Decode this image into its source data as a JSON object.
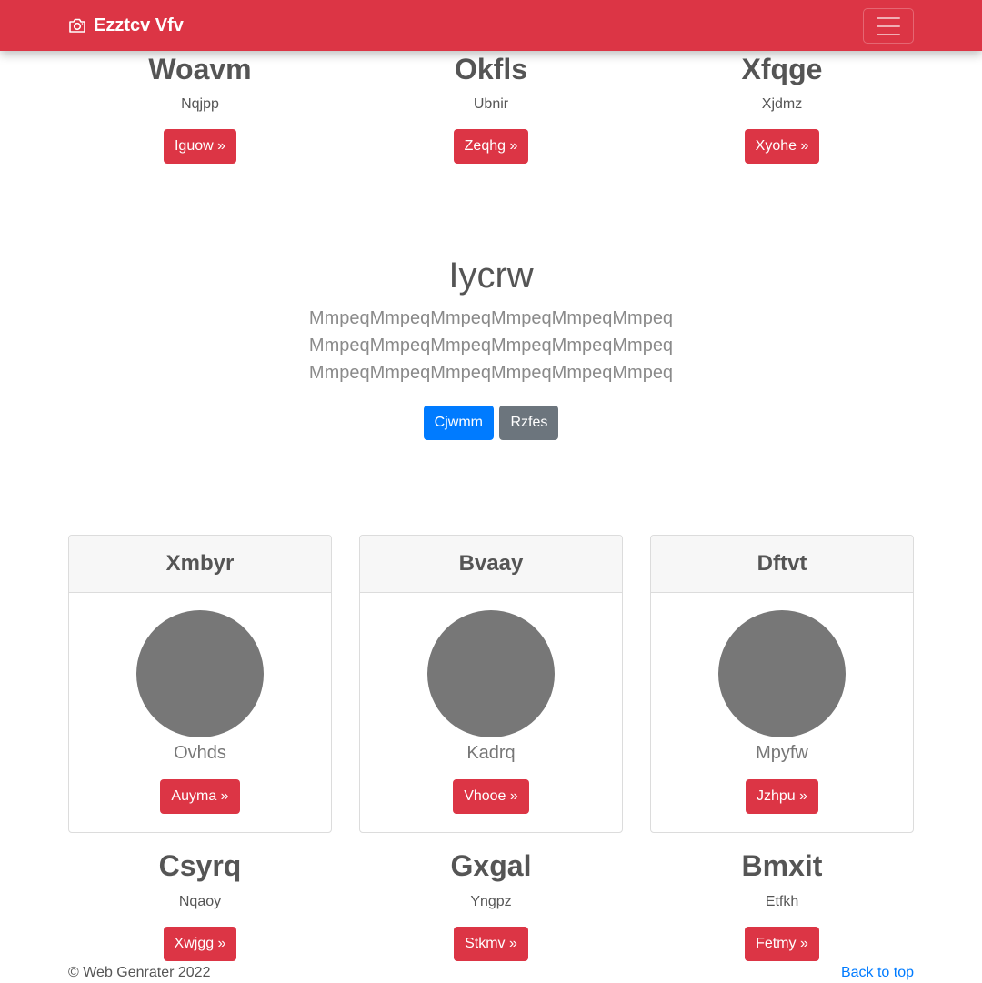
{
  "navbar": {
    "brand": "Ezztcv Vfv",
    "icon": "camera-icon",
    "toggler_icon": "hamburger-icon",
    "color": "#dc3545"
  },
  "features": [
    {
      "title": "Woavm",
      "text": "Nqjpp",
      "button": "Iguow »"
    },
    {
      "title": "Okfls",
      "text": "Ubnir",
      "button": "Zeqhg »"
    },
    {
      "title": "Xfqge",
      "text": "Xjdmz",
      "button": "Xyohe »"
    }
  ],
  "jumbotron": {
    "title": "Iycrw",
    "lines": [
      "MmpeqMmpeqMmpeqMmpeqMmpeqMmpeq",
      "MmpeqMmpeqMmpeqMmpeqMmpeqMmpeq",
      "MmpeqMmpeqMmpeqMmpeqMmpeqMmpeq"
    ],
    "primary_button": "Cjwmm",
    "secondary_button": "Rzfes"
  },
  "cards": [
    {
      "header": "Xmbyr",
      "name": "Ovhds",
      "button": "Auyma »"
    },
    {
      "header": "Bvaay",
      "name": "Kadrq",
      "button": "Vhooe »"
    },
    {
      "header": "Dftvt",
      "name": "Mpyfw",
      "button": "Jzhpu »"
    }
  ],
  "features2": [
    {
      "title": "Csyrq",
      "text": "Nqaoy",
      "button": "Xwjgg »"
    },
    {
      "title": "Gxgal",
      "text": "Yngpz",
      "button": "Stkmv »"
    },
    {
      "title": "Bmxit",
      "text": "Etfkh",
      "button": "Fetmy »"
    }
  ],
  "footer": {
    "copyright": "© Web Genrater 2022",
    "back_to_top": "Back to top"
  }
}
